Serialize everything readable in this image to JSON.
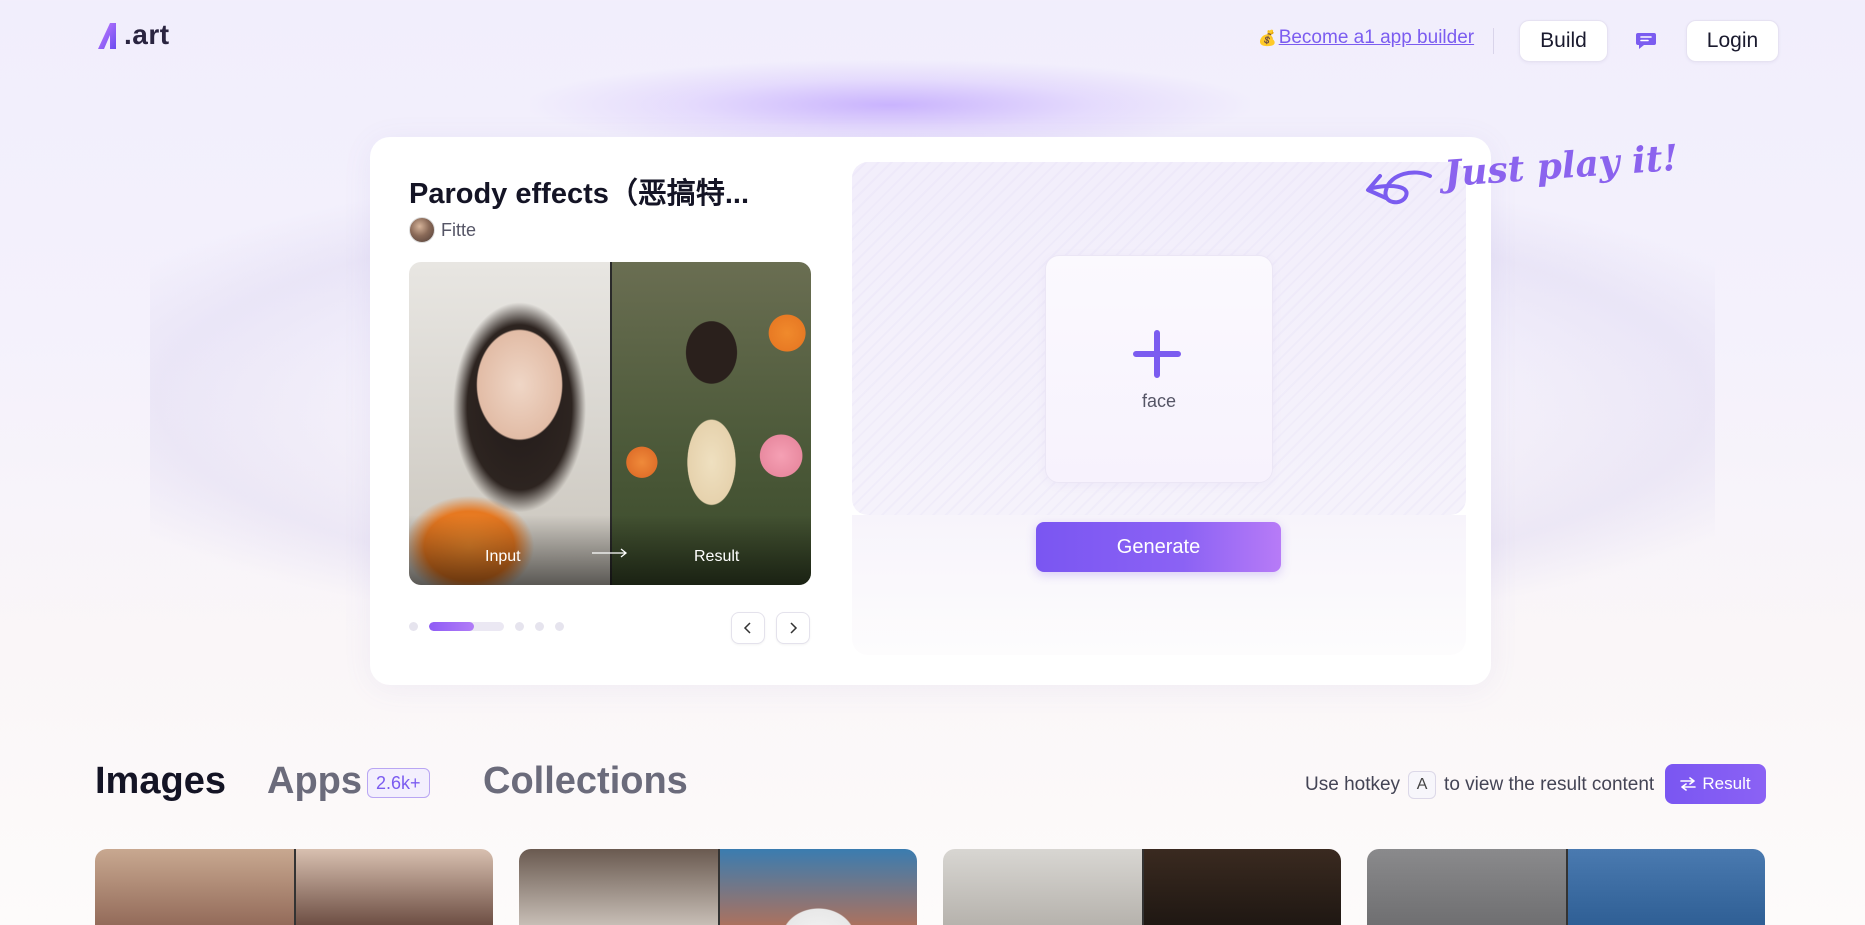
{
  "header": {
    "logo_text": ".art",
    "builder_link": "Become a1 app builder",
    "build_label": "Build",
    "login_label": "Login"
  },
  "app": {
    "title": "Parody effects（恶搞特...",
    "author": "Fitte",
    "preview": {
      "input_label": "Input",
      "result_label": "Result"
    },
    "carousel": {
      "total_items": 6,
      "active_index": 1
    },
    "play_hint": "Just play it!",
    "upload_label": "face",
    "generate_label": "Generate"
  },
  "tabs": {
    "images": "Images",
    "apps": "Apps",
    "apps_count": "2.6k+",
    "collections": "Collections"
  },
  "hotkey": {
    "prefix": "Use hotkey",
    "key": "A",
    "suffix": "to view the result content",
    "result_button": "Result"
  },
  "colors": {
    "accent": "#7b5cf0",
    "button_gradient_start": "#7a56f2",
    "button_gradient_end": "#b77bf7"
  },
  "icons": {
    "logo": "a1-logo-icon",
    "chat": "chat-bubble-icon",
    "money_bag": "money-bag-icon",
    "prev": "chevron-left-icon",
    "next": "chevron-right-icon",
    "upload": "plus-icon",
    "result": "swap-icon"
  }
}
